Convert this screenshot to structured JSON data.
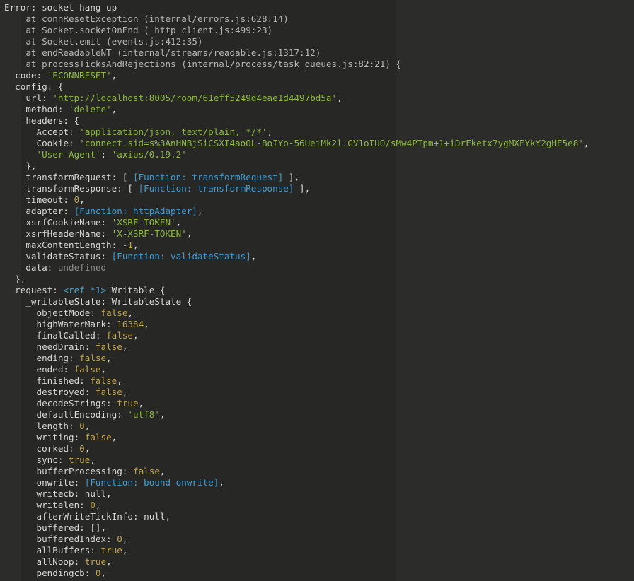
{
  "terminal": {
    "lines": [
      [
        [
          "Error: socket hang up",
          "p"
        ]
      ],
      [
        [
          "    at connResetException (internal/errors.js:628:14)",
          "d"
        ]
      ],
      [
        [
          "    at Socket.socketOnEnd (_http_client.js:499:23)",
          "d"
        ]
      ],
      [
        [
          "    at Socket.emit (events.js:412:35)",
          "d"
        ]
      ],
      [
        [
          "    at endReadableNT (internal/streams/readable.js:1317:12)",
          "d"
        ]
      ],
      [
        [
          "    at processTicksAndRejections (internal/process/task_queues.js:82:21) {",
          "d"
        ]
      ],
      [
        [
          "  code: ",
          "p"
        ],
        [
          "'ECONNRESET'",
          "s"
        ],
        [
          ",",
          "p"
        ]
      ],
      [
        [
          "  config: {",
          "p"
        ]
      ],
      [
        [
          "    url: ",
          "p"
        ],
        [
          "'http://localhost:8005/room/61eff5249d4eae1d4497bd5a'",
          "s"
        ],
        [
          ",",
          "p"
        ]
      ],
      [
        [
          "    method: ",
          "p"
        ],
        [
          "'delete'",
          "s"
        ],
        [
          ",",
          "p"
        ]
      ],
      [
        [
          "    headers: {",
          "p"
        ]
      ],
      [
        [
          "      Accept: ",
          "p"
        ],
        [
          "'application/json, text/plain, */*'",
          "s"
        ],
        [
          ",",
          "p"
        ]
      ],
      [
        [
          "      Cookie: ",
          "p"
        ],
        [
          "'connect.sid=s%3AnHNBjSiCSXI4aoOL-BoIYo-56UeiMk2l.GV1oIUO/sMw4PTpm+1+iDrFketx7ygMXFYkY2gHE5e8'",
          "s"
        ],
        [
          ",",
          "p"
        ]
      ],
      [
        [
          "      ",
          "p"
        ],
        [
          "'User-Agent'",
          "s"
        ],
        [
          ": ",
          "p"
        ],
        [
          "'axios/0.19.2'",
          "s"
        ]
      ],
      [
        [
          "    },",
          "p"
        ]
      ],
      [
        [
          "    transformRequest: [ ",
          "p"
        ],
        [
          "[Function: transformRequest]",
          "f"
        ],
        [
          " ],",
          "p"
        ]
      ],
      [
        [
          "    transformResponse: [ ",
          "p"
        ],
        [
          "[Function: transformResponse]",
          "f"
        ],
        [
          " ],",
          "p"
        ]
      ],
      [
        [
          "    timeout: ",
          "p"
        ],
        [
          "0",
          "n"
        ],
        [
          ",",
          "p"
        ]
      ],
      [
        [
          "    adapter: ",
          "p"
        ],
        [
          "[Function: httpAdapter]",
          "f"
        ],
        [
          ",",
          "p"
        ]
      ],
      [
        [
          "    xsrfCookieName: ",
          "p"
        ],
        [
          "'XSRF-TOKEN'",
          "s"
        ],
        [
          ",",
          "p"
        ]
      ],
      [
        [
          "    xsrfHeaderName: ",
          "p"
        ],
        [
          "'X-XSRF-TOKEN'",
          "s"
        ],
        [
          ",",
          "p"
        ]
      ],
      [
        [
          "    maxContentLength: ",
          "p"
        ],
        [
          "-1",
          "n"
        ],
        [
          ",",
          "p"
        ]
      ],
      [
        [
          "    validateStatus: ",
          "p"
        ],
        [
          "[Function: validateStatus]",
          "f"
        ],
        [
          ",",
          "p"
        ]
      ],
      [
        [
          "    data: ",
          "p"
        ],
        [
          "undefined",
          "u"
        ]
      ],
      [
        [
          "  },",
          "p"
        ]
      ],
      [
        [
          "  request: ",
          "p"
        ],
        [
          "<ref *1>",
          "r"
        ],
        [
          " Writable {",
          "p"
        ]
      ],
      [
        [
          "    _writableState: WritableState {",
          "p"
        ]
      ],
      [
        [
          "      objectMode: ",
          "p"
        ],
        [
          "false",
          "n"
        ],
        [
          ",",
          "p"
        ]
      ],
      [
        [
          "      highWaterMark: ",
          "p"
        ],
        [
          "16384",
          "n"
        ],
        [
          ",",
          "p"
        ]
      ],
      [
        [
          "      finalCalled: ",
          "p"
        ],
        [
          "false",
          "n"
        ],
        [
          ",",
          "p"
        ]
      ],
      [
        [
          "      needDrain: ",
          "p"
        ],
        [
          "false",
          "n"
        ],
        [
          ",",
          "p"
        ]
      ],
      [
        [
          "      ending: ",
          "p"
        ],
        [
          "false",
          "n"
        ],
        [
          ",",
          "p"
        ]
      ],
      [
        [
          "      ended: ",
          "p"
        ],
        [
          "false",
          "n"
        ],
        [
          ",",
          "p"
        ]
      ],
      [
        [
          "      finished: ",
          "p"
        ],
        [
          "false",
          "n"
        ],
        [
          ",",
          "p"
        ]
      ],
      [
        [
          "      destroyed: ",
          "p"
        ],
        [
          "false",
          "n"
        ],
        [
          ",",
          "p"
        ]
      ],
      [
        [
          "      decodeStrings: ",
          "p"
        ],
        [
          "true",
          "n"
        ],
        [
          ",",
          "p"
        ]
      ],
      [
        [
          "      defaultEncoding: ",
          "p"
        ],
        [
          "'utf8'",
          "s"
        ],
        [
          ",",
          "p"
        ]
      ],
      [
        [
          "      length: ",
          "p"
        ],
        [
          "0",
          "n"
        ],
        [
          ",",
          "p"
        ]
      ],
      [
        [
          "      writing: ",
          "p"
        ],
        [
          "false",
          "n"
        ],
        [
          ",",
          "p"
        ]
      ],
      [
        [
          "      corked: ",
          "p"
        ],
        [
          "0",
          "n"
        ],
        [
          ",",
          "p"
        ]
      ],
      [
        [
          "      sync: ",
          "p"
        ],
        [
          "true",
          "n"
        ],
        [
          ",",
          "p"
        ]
      ],
      [
        [
          "      bufferProcessing: ",
          "p"
        ],
        [
          "false",
          "n"
        ],
        [
          ",",
          "p"
        ]
      ],
      [
        [
          "      onwrite: ",
          "p"
        ],
        [
          "[Function: bound onwrite]",
          "f"
        ],
        [
          ",",
          "p"
        ]
      ],
      [
        [
          "      writecb: null,",
          "p"
        ]
      ],
      [
        [
          "      writelen: ",
          "p"
        ],
        [
          "0",
          "n"
        ],
        [
          ",",
          "p"
        ]
      ],
      [
        [
          "      afterWriteTickInfo: null,",
          "p"
        ]
      ],
      [
        [
          "      buffered: [],",
          "p"
        ]
      ],
      [
        [
          "      bufferedIndex: ",
          "p"
        ],
        [
          "0",
          "n"
        ],
        [
          ",",
          "p"
        ]
      ],
      [
        [
          "      allBuffers: ",
          "p"
        ],
        [
          "true",
          "n"
        ],
        [
          ",",
          "p"
        ]
      ],
      [
        [
          "      allNoop: ",
          "p"
        ],
        [
          "true",
          "n"
        ],
        [
          ",",
          "p"
        ]
      ],
      [
        [
          "      pendingcb: ",
          "p"
        ],
        [
          "0",
          "n"
        ],
        [
          ",",
          "p"
        ]
      ]
    ]
  },
  "colors": {
    "background": "#272826",
    "string": "#8db83c",
    "number": "#bfa451",
    "function": "#3e9bd3"
  }
}
